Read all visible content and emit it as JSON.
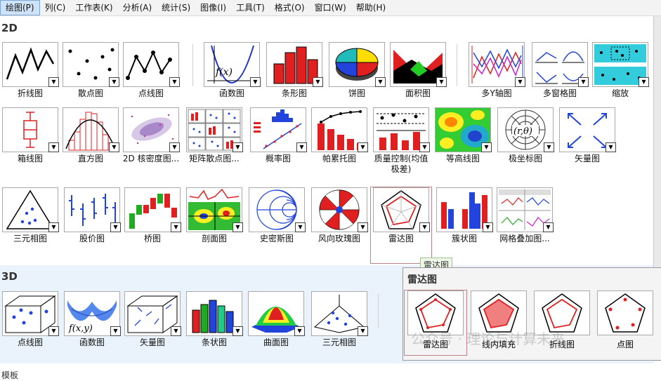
{
  "menu": [
    "绘图(P)",
    "列(C)",
    "工作表(K)",
    "分析(A)",
    "统计(S)",
    "图像(I)",
    "工具(T)",
    "格式(O)",
    "窗口(W)",
    "帮助(H)"
  ],
  "sections": {
    "two_d": "2D",
    "three_d": "3D",
    "bottom_partial": "模板"
  },
  "row1": [
    "折线图",
    "散点图",
    "点线图",
    "函数图",
    "条形图",
    "饼图",
    "面积图",
    "多Y轴图",
    "多窗格图",
    "缩放"
  ],
  "row2": [
    "箱线图",
    "直方图",
    "2D 核密度图...",
    "矩阵散点图...",
    "概率图",
    "帕累托图",
    "质量控制(均值极差)",
    "等高线图",
    "极坐标图",
    "矢量图"
  ],
  "row3": [
    "三元相图",
    "股价图",
    "桥图",
    "剖面图",
    "史密斯图",
    "风向玫瑰图",
    "雷达图",
    "簇状图",
    "网格叠加图..."
  ],
  "row3d": [
    "点线图",
    "函数图",
    "矢量图",
    "条状图",
    "曲面图",
    "三元相图"
  ],
  "tooltip": "雷达图",
  "popup": {
    "title": "雷达图",
    "items": [
      "雷达图",
      "线内填充",
      "折线图",
      "点图"
    ]
  },
  "watermark": "公众号 · 理论与计算未来",
  "arrow_glyph": "▼",
  "colors": {
    "accent_red": "#e02020",
    "menu_highlight": "#cfe3f8",
    "section3d_bg": "#eaf3fb"
  }
}
